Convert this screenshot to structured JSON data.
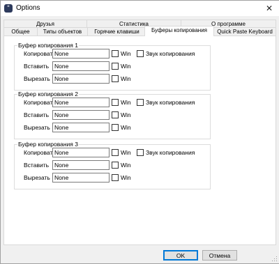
{
  "window": {
    "title": "Options",
    "close_glyph": "✕",
    "icon_glyph": "\""
  },
  "tabs": {
    "row1": [
      {
        "label": "Друзья"
      },
      {
        "label": "Статистика"
      },
      {
        "label": "О программе"
      }
    ],
    "row2": [
      {
        "label": "Общее"
      },
      {
        "label": "Типы объектов"
      },
      {
        "label": "Горячие клавиши"
      },
      {
        "label": "Буферы копирования",
        "active": true
      },
      {
        "label": "Quick Paste Keyboard"
      }
    ]
  },
  "groups": [
    {
      "title": "Буфер копирования 1",
      "rows": [
        {
          "label": "Копировать",
          "value": "None",
          "win": "Win",
          "sound": "Звук копирования"
        },
        {
          "label": "Вставить",
          "value": "None",
          "win": "Win"
        },
        {
          "label": "Вырезать",
          "value": "None",
          "win": "Win"
        }
      ]
    },
    {
      "title": "Буфер копирования 2",
      "rows": [
        {
          "label": "Копировать",
          "value": "None",
          "win": "Win",
          "sound": "Звук копирования"
        },
        {
          "label": "Вставить",
          "value": "None",
          "win": "Win"
        },
        {
          "label": "Вырезать",
          "value": "None",
          "win": "Win"
        }
      ]
    },
    {
      "title": "Буфер копирования 3",
      "rows": [
        {
          "label": "Копировать",
          "value": "None",
          "win": "Win",
          "sound": "Звук копирования"
        },
        {
          "label": "Вставить",
          "value": "None",
          "win": "Win"
        },
        {
          "label": "Вырезать",
          "value": "None",
          "win": "Win"
        }
      ]
    }
  ],
  "buttons": {
    "ok": "OK",
    "cancel": "Отмена"
  },
  "colors": {
    "accent": "#0078d7",
    "app_icon": "#2d3a5c"
  }
}
